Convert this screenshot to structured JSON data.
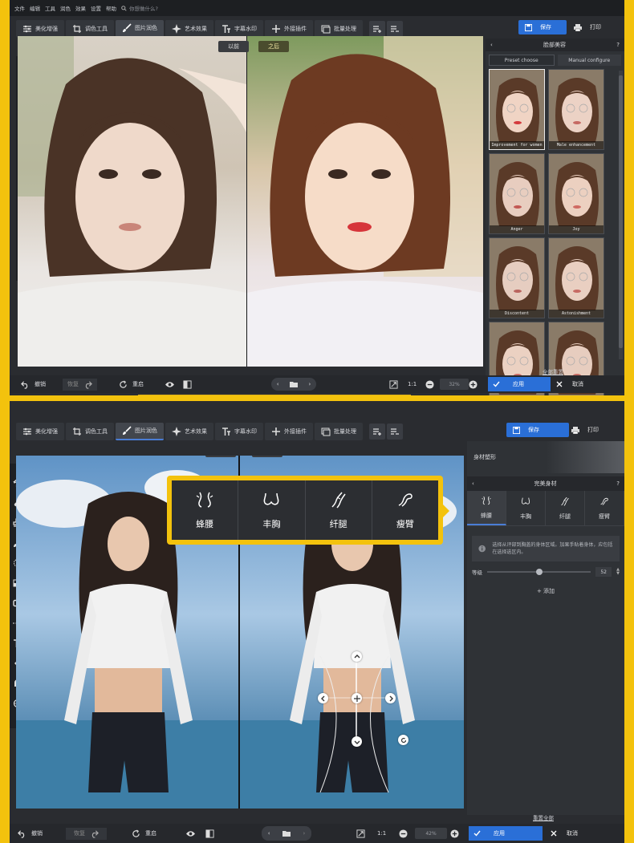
{
  "menu": {
    "items": [
      "文件",
      "编辑",
      "工具",
      "润色",
      "效果",
      "设置",
      "帮助"
    ],
    "search_placeholder": "你想做什么?"
  },
  "toolbar": {
    "items": [
      {
        "label": "美化增强",
        "icon": "sliders-icon"
      },
      {
        "label": "调色工具",
        "icon": "crop-icon"
      },
      {
        "label": "图片润色",
        "icon": "brush-icon"
      },
      {
        "label": "艺术效果",
        "icon": "sparkle-icon"
      },
      {
        "label": "字幕水印",
        "icon": "text-icon"
      },
      {
        "label": "外接插件",
        "icon": "plus-icon"
      },
      {
        "label": "批量处理",
        "icon": "batch-icon"
      }
    ],
    "active_index": 2,
    "save": "保存",
    "print": "打印"
  },
  "compare": {
    "before": "以前",
    "after": "之后"
  },
  "bottom": {
    "undo": "撤销",
    "redo": "恢复",
    "reset": "重启",
    "ratio": "1:1",
    "zoom_top": "32%",
    "zoom_bottom": "42%",
    "apply": "应用",
    "cancel": "取消"
  },
  "beauty_panel": {
    "title": "脸部美容",
    "tabs": [
      "Preset choose",
      "Manual configure"
    ],
    "active_tab": 0,
    "presets": [
      {
        "caption": "Improvement for women",
        "selected": true
      },
      {
        "caption": "Male enhancement",
        "selected": false
      },
      {
        "caption": "Anger",
        "selected": false
      },
      {
        "caption": "Joy",
        "selected": false
      },
      {
        "caption": "Discontent",
        "selected": false
      },
      {
        "caption": "Astonishment",
        "selected": false
      },
      {
        "caption": "",
        "selected": false
      },
      {
        "caption": "",
        "selected": false
      }
    ],
    "reset_all": "全部重置"
  },
  "body_panel": {
    "header": "身材塑形",
    "title": "完美身材",
    "tabs": [
      {
        "label": "蜂腰",
        "icon": "waist-icon"
      },
      {
        "label": "丰胸",
        "icon": "bust-icon"
      },
      {
        "label": "纤腿",
        "icon": "leg-icon"
      },
      {
        "label": "瘦臂",
        "icon": "arm-icon"
      }
    ],
    "active_tab": 0,
    "info": "选择从评部到胸盖的身体区域。加果手贴着身体，应包括在选择选区内。",
    "level_label": "等级",
    "level_value": "52",
    "level_fraction": 0.5,
    "add": "添加",
    "reset_all": "重置全部"
  },
  "callout": {
    "items": [
      {
        "label": "蜂腰",
        "icon": "waist-icon"
      },
      {
        "label": "丰胸",
        "icon": "bust-icon"
      },
      {
        "label": "纤腿",
        "icon": "leg-icon"
      },
      {
        "label": "瘦臂",
        "icon": "arm-icon"
      }
    ]
  },
  "colors": {
    "accent": "#2a6fd7",
    "frame": "#f3c20d",
    "bg": "#2a2c30"
  }
}
